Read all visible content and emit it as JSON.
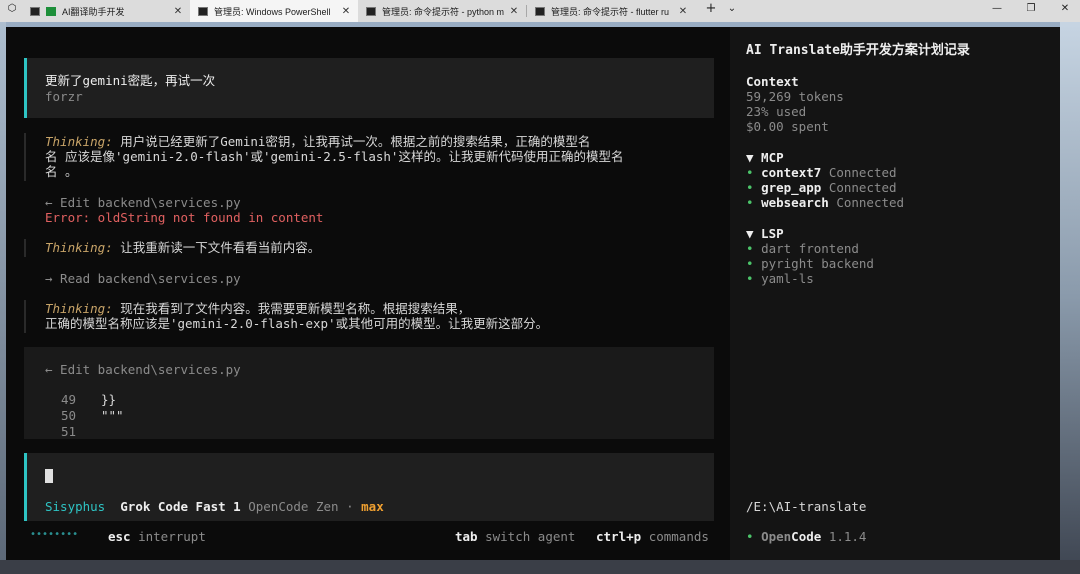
{
  "tabs": [
    {
      "label": "AI翻译助手开发",
      "active": false
    },
    {
      "label": "管理员: Windows PowerShell",
      "active": true
    },
    {
      "label": "管理员: 命令提示符 - python  m",
      "active": false
    },
    {
      "label": "管理员: 命令提示符 - flutter  ru",
      "active": false
    }
  ],
  "tabbar": {
    "new_tab": "+",
    "dropdown": "⌄",
    "minimize": "—",
    "maximize": "❐",
    "close": "✕"
  },
  "user_message": {
    "text": "更新了gemini密匙，再试一次",
    "author": "forzr"
  },
  "transcript": {
    "thinking1_label": "Thinking:",
    "thinking1_line1": " 用户说已经更新了Gemini密钥，让我再试一次。根据之前的搜索结果，正确的模型名",
    "thinking1_line2": "名 应该是像'gemini-2.0-flash'或'gemini-2.5-flash'这样的。让我更新代码使用正确的模型名",
    "thinking1_line3": "名 。",
    "edit1": "← Edit backend\\services.py",
    "error1": "Error: oldString not found in content",
    "thinking2_label": "Thinking:",
    "thinking2_text": " 让我重新读一下文件看看当前内容。",
    "read1": "→ Read backend\\services.py",
    "thinking3_label": "Thinking:",
    "thinking3_line1": " 现在我看到了文件内容。我需要更新模型名称。根据搜索结果，",
    "thinking3_line2": "正确的模型名称应该是'gemini-2.0-flash-exp'或其他可用的模型。让我更新这部分。",
    "edit2": "← Edit backend\\services.py",
    "code_lines": [
      {
        "num": "49",
        "code": "}}"
      },
      {
        "num": "50",
        "code": "\"\"\""
      },
      {
        "num": "51",
        "code": ""
      }
    ]
  },
  "input": {
    "agent": "Sisyphus",
    "model": "Grok Code Fast 1",
    "provider": "OpenCode Zen",
    "sep": "·",
    "mode": "max"
  },
  "status": {
    "dots": "••••••••",
    "esc_key": "esc",
    "esc_label": "interrupt",
    "tab_key": "tab",
    "tab_label": "switch agent",
    "ctrlp_key": "ctrl+p",
    "ctrlp_label": "commands"
  },
  "sidebar": {
    "title": "AI Translate助手开发方案计划记录",
    "context_heading": "Context",
    "tokens": "59,269 tokens",
    "used": "23% used",
    "spent": "$0.00 spent",
    "mcp_heading": "▼ MCP",
    "mcp_items": [
      {
        "name": "context7",
        "status": "Connected"
      },
      {
        "name": "grep_app",
        "status": "Connected"
      },
      {
        "name": "websearch",
        "status": "Connected"
      }
    ],
    "lsp_heading": "▼ LSP",
    "lsp_items": [
      "dart frontend",
      "pyright backend",
      "yaml-ls"
    ],
    "path": "/E:\\AI-translate",
    "app_name_a": "Open",
    "app_name_b": "Code",
    "version": "1.1.4"
  },
  "colors": {
    "accent": "#2ec4c4",
    "thinking": "#c8a468",
    "error": "#e06060",
    "mode": "#f0a030",
    "bullet": "#4cc46a"
  }
}
